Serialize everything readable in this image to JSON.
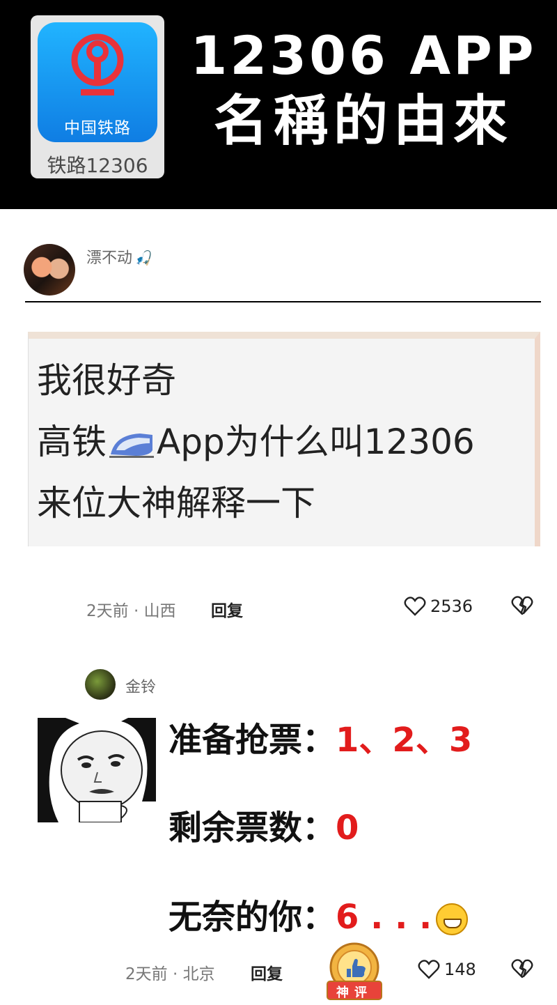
{
  "banner": {
    "app_icon_text": "中国铁路",
    "app_name": "铁路12306",
    "title_line1": "12306 APP",
    "title_line2": "名稱的由來",
    "colors": {
      "background": "#000000",
      "icon_gradient_top": "#21b4ff",
      "icon_gradient_bottom": "#0f7de3",
      "logo": "#e8333a"
    }
  },
  "post": {
    "username": "漂不动",
    "username_badge_icon": "fishing-rod-icon",
    "quote_lines": [
      "我很好奇",
      "高铁",
      "App为什么叫12306",
      "来位大神解释一下"
    ],
    "time_location": "2天前 · 山西",
    "reply_label": "回复",
    "like_count": "2536"
  },
  "comment": {
    "username": "金铃",
    "rows": [
      {
        "label": "准备抢票：",
        "value": "1、2、3"
      },
      {
        "label": "剩余票数：",
        "value": "0"
      },
      {
        "label": "无奈的你：",
        "value": "6 . . ."
      }
    ],
    "time_location": "2天前 · 北京",
    "reply_label": "回复",
    "like_count": "148",
    "badge_text": "神评",
    "colors": {
      "value_red": "#e21c1c"
    }
  }
}
